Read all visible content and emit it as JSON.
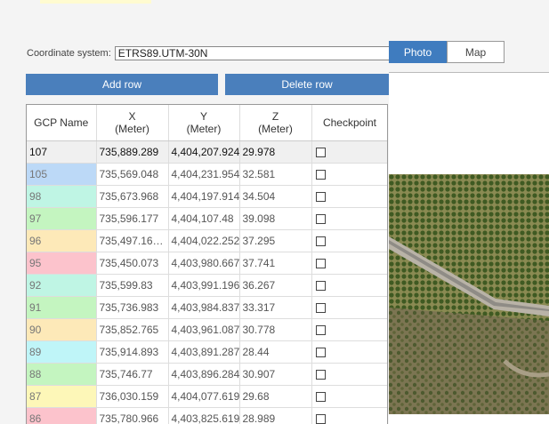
{
  "coordinate_system": {
    "label": "Coordinate system:",
    "value": "ETRS89.UTM-30N"
  },
  "tabs": [
    {
      "label": "Photo",
      "active": true
    },
    {
      "label": "Map",
      "active": false
    }
  ],
  "buttons": {
    "add_row": "Add row",
    "delete_row": "Delete row"
  },
  "table": {
    "headers": [
      {
        "line1": "GCP Name",
        "line2": ""
      },
      {
        "line1": "X",
        "line2": "(Meter)"
      },
      {
        "line1": "Y",
        "line2": "(Meter)"
      },
      {
        "line1": "Z",
        "line2": "(Meter)"
      },
      {
        "line1": "Checkpoint",
        "line2": ""
      }
    ],
    "rows": [
      {
        "name": "107",
        "x": "735,889.289",
        "y": "4,404,207.924",
        "z": "29.978",
        "color": "#f0f0f0",
        "selected": true
      },
      {
        "name": "105",
        "x": "735,569.048",
        "y": "4,404,231.954",
        "z": "32.581",
        "color": "#bcd9f7"
      },
      {
        "name": "98",
        "x": "735,673.968",
        "y": "4,404,197.914",
        "z": "34.504",
        "color": "#bff5e4"
      },
      {
        "name": "97",
        "x": "735,596.177",
        "y": "4,404,107.48",
        "z": "39.098",
        "color": "#c4f5c0"
      },
      {
        "name": "96",
        "x": "735,497.16…",
        "y": "4,404,022.252",
        "z": "37.295",
        "color": "#fde9b8"
      },
      {
        "name": "95",
        "x": "735,450.073",
        "y": "4,403,980.667",
        "z": "37.741",
        "color": "#fcc3cc"
      },
      {
        "name": "92",
        "x": "735,599.83",
        "y": "4,403,991.196",
        "z": "36.267",
        "color": "#bff5e4"
      },
      {
        "name": "91",
        "x": "735,736.983",
        "y": "4,403,984.837",
        "z": "33.317",
        "color": "#c4f5c0"
      },
      {
        "name": "90",
        "x": "735,852.765",
        "y": "4,403,961.087",
        "z": "30.778",
        "color": "#fde9b8"
      },
      {
        "name": "89",
        "x": "735,914.893",
        "y": "4,403,891.287",
        "z": "28.44",
        "color": "#bff5f8"
      },
      {
        "name": "88",
        "x": "735,746.77",
        "y": "4,403,896.284",
        "z": "30.907",
        "color": "#c4f5c0"
      },
      {
        "name": "87",
        "x": "736,030.159",
        "y": "4,404,077.619",
        "z": "29.68",
        "color": "#fdf7b8"
      },
      {
        "name": "86",
        "x": "735,780.966",
        "y": "4,403,825.619",
        "z": "28.989",
        "color": "#fcc3cc"
      }
    ]
  }
}
